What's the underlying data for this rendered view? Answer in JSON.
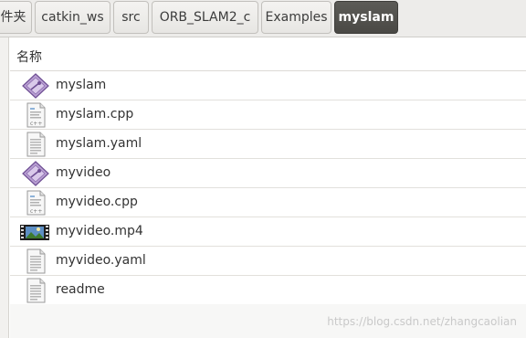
{
  "breadcrumbs": [
    {
      "label": "件夹",
      "active": false
    },
    {
      "label": "catkin_ws",
      "active": false
    },
    {
      "label": "src",
      "active": false
    },
    {
      "label": "ORB_SLAM2_c",
      "active": false
    },
    {
      "label": "Examples",
      "active": false
    },
    {
      "label": "myslam",
      "active": true
    }
  ],
  "columns": {
    "name": "名称"
  },
  "files": [
    {
      "name": "myslam",
      "icon": "executable-icon"
    },
    {
      "name": "myslam.cpp",
      "icon": "cpp-file-icon"
    },
    {
      "name": "myslam.yaml",
      "icon": "text-file-icon"
    },
    {
      "name": "myvideo",
      "icon": "executable-icon"
    },
    {
      "name": "myvideo.cpp",
      "icon": "cpp-file-icon"
    },
    {
      "name": "myvideo.mp4",
      "icon": "video-file-icon"
    },
    {
      "name": "myvideo.yaml",
      "icon": "text-file-icon"
    },
    {
      "name": "readme",
      "icon": "text-file-icon"
    }
  ],
  "watermark": "https://blog.csdn.net/zhangcaolian"
}
